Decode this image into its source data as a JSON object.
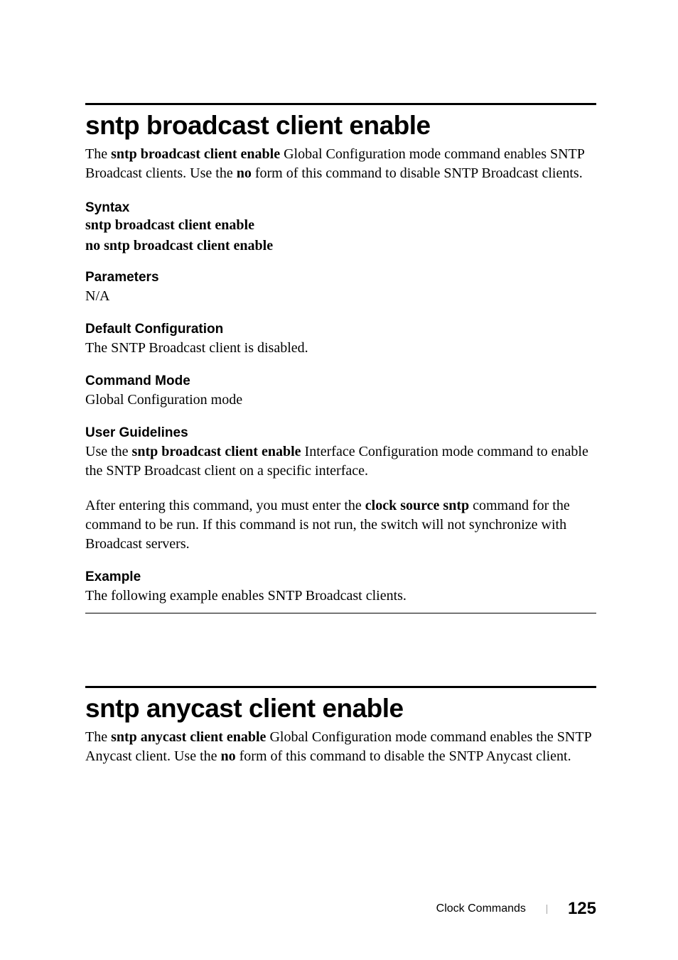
{
  "section1": {
    "title": "sntp broadcast client enable",
    "intro_pre": "The ",
    "intro_cmd": "sntp broadcast client enable",
    "intro_mid": " Global Configuration mode command enables SNTP Broadcast clients. Use the ",
    "intro_no": "no",
    "intro_post": " form of this command to disable SNTP Broadcast clients.",
    "syntax_head": "Syntax",
    "syntax1": "sntp broadcast client enable",
    "syntax2": "no sntp broadcast client enable",
    "params_head": "Parameters",
    "params_body": "N/A",
    "default_head": "Default Configuration",
    "default_body": "The SNTP Broadcast client is disabled.",
    "mode_head": "Command Mode",
    "mode_body": "Global Configuration mode",
    "guide_head": "User Guidelines",
    "guide_p1_pre": "Use the ",
    "guide_p1_cmd": "sntp broadcast client enable",
    "guide_p1_post": " Interface Configuration mode command to enable the SNTP Broadcast client on a specific interface.",
    "guide_p2_pre": "After entering this command, you must enter the ",
    "guide_p2_cmd": "clock source sntp",
    "guide_p2_post": " command for the command to be run. If this command is not run, the switch will not synchronize with Broadcast servers.",
    "example_head": "Example",
    "example_body": "The following example enables SNTP Broadcast clients."
  },
  "section2": {
    "title": "sntp anycast client enable",
    "intro_pre": "The ",
    "intro_cmd": "sntp anycast client enable",
    "intro_mid": " Global Configuration mode command enables the SNTP Anycast client. Use the ",
    "intro_no": "no",
    "intro_post": " form of this command to disable the SNTP Anycast client."
  },
  "footer": {
    "section": "Clock Commands",
    "page": "125"
  }
}
